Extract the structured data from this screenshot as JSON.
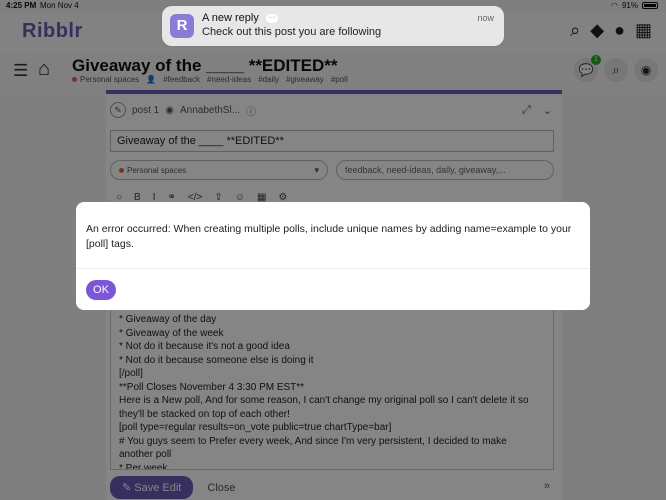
{
  "statusbar": {
    "time": "4:25 PM",
    "date": "Mon Nov 4",
    "battery": "91%"
  },
  "header": {
    "logo": "Ribblr"
  },
  "topic": {
    "title": "Giveaway of the ____ **EDITED**",
    "category": "Personal spaces",
    "tags": [
      "#feedback",
      "#need-ideas",
      "#daily",
      "#giveaway",
      "#poll"
    ],
    "chat_badge": "1"
  },
  "composer": {
    "post_label": "post 1",
    "author": "AnnabethSl...",
    "title_value": "Giveaway of the ____ **EDITED**",
    "category_value": "Personal spaces",
    "tags_value": "feedback, need-ideas, daily, giveaway,...",
    "editor_lines": [
      "* Giveaway of the day",
      "* Giveaway of the week",
      "* Not do it because it's not a good idea",
      "* Not do it because someone else is doing it",
      "[/poll]",
      "**Poll Closes November 4 3:30 PM EST**",
      "Here is a New poll, And for some reason, I can't change my original poll so I can't delete it so",
      "they'll be stacked on top of each other!",
      "[poll type=regular results=on_vote public=true chartType=bar]",
      "# You guys seem to Prefer every week, And since I'm very persistent, I decided to make",
      "another poll",
      "* Per week"
    ],
    "save_label": "Save Edit",
    "close_label": "Close"
  },
  "notification": {
    "title": "A new reply",
    "body": "Check out this post you are following",
    "time": "now"
  },
  "modal": {
    "message": "An error occurred: When creating multiple polls, include unique names by adding name=example to your [poll] tags.",
    "ok_label": "OK"
  }
}
